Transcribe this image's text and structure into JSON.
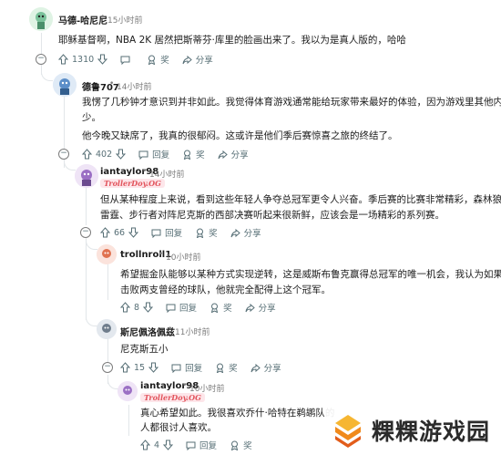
{
  "comments": [
    {
      "user": "马德-哈尼尼",
      "time": "15小时前",
      "body": "耶稣基督啊，NBA 2K 居然把斯蒂芬·库里的脸画出来了。我以为是真人版的，哈哈",
      "votes": "1310",
      "reply": "",
      "award": "奖",
      "share": "分享"
    },
    {
      "user": "德鲁707",
      "time": "14小时前",
      "body_lines": [
        "我愣了几秒钟才意识到并非如此。我觉得体育游戏通常能给玩家带来最好的体验，因为游戏里其他内容很",
        "少。",
        "他今晚又缺席了，我真的很郁闷。这或许是他们季后赛惊喜之旅的终结了。"
      ],
      "votes": "402",
      "reply": "回复",
      "award": "奖",
      "share": "分享"
    },
    {
      "user": "iantaylor98",
      "time": "14小时前",
      "flair": "TrollerDoy.OG",
      "body_lines": [
        "但从某种程度上来说，看到这些年轻人争夺总冠军更令人兴奋。季后赛的比赛非常精彩，森林狼对阵",
        "雷霆、步行者对阵尼克斯的西部决赛听起来很新鲜，应该会是一场精彩的系列赛。"
      ],
      "votes": "66",
      "reply": "回复",
      "award": "奖",
      "share": "分享"
    },
    {
      "user": "trollnroll1",
      "time": "10小时前",
      "body_lines": [
        "希望掘金队能够以某种方式实现逆转，这是威斯布鲁克赢得总冠军的唯一机会，我认为如果他能",
        "击败两支曾经的球队，他就完全配得上这个冠军。"
      ],
      "votes": "8",
      "reply": "回复",
      "award": "奖",
      "share": "分享"
    },
    {
      "user": "斯尼佩洛佩兹",
      "time": "11小时前",
      "body": "尼克斯五小",
      "votes": "15",
      "reply": "回复",
      "award": "奖",
      "share": "分享"
    },
    {
      "user": "iantaylor98",
      "time": "10小时前",
      "flair": "TrollerDoy.OG",
      "body_lines": [
        "真心希望如此。我很喜欢乔什·哈特在鹈鹕队的",
        "人都很讨人喜欢。"
      ],
      "votes": "4",
      "reply": "回复",
      "award": "奖"
    }
  ],
  "watermark": "粿粿游戏园",
  "colors": {
    "text": "#1c1c1c",
    "meta": "#7c7c7c",
    "action": "#576f76",
    "thread_line": "#e2e6e9",
    "flair_text": "#e2545c",
    "flair_bg": "#fde6ea"
  }
}
